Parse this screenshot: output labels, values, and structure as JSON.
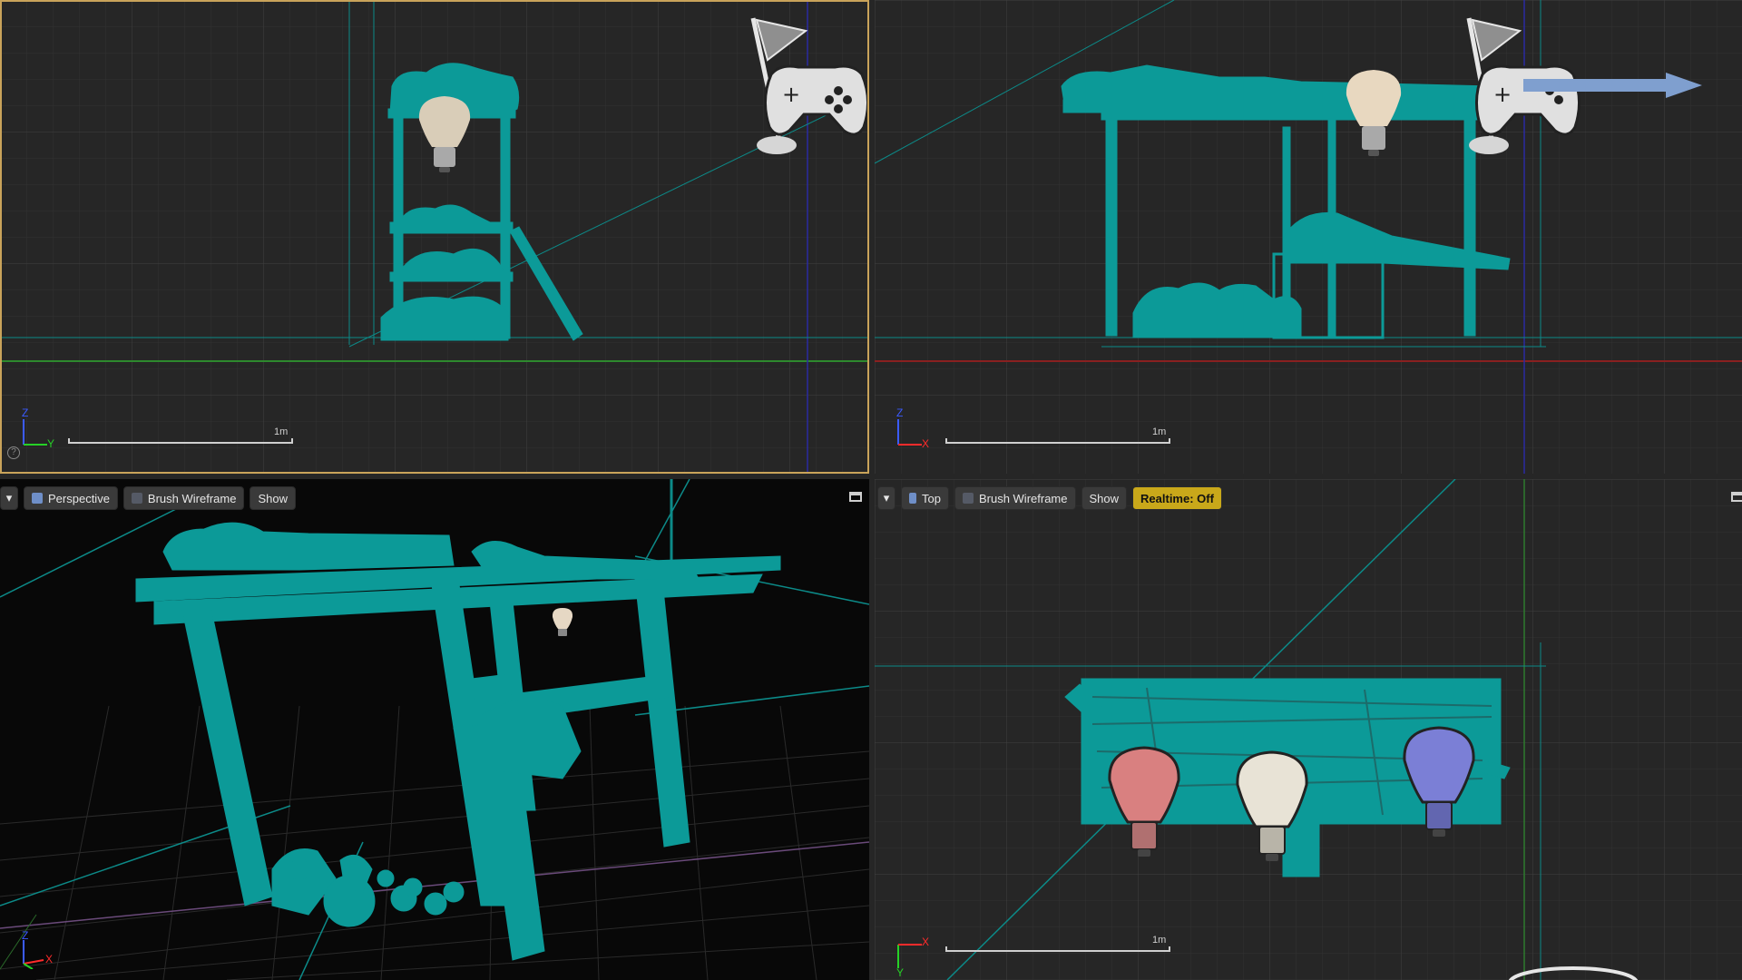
{
  "viewports": {
    "side": {
      "scale_label": "1m",
      "axis_up": "Z",
      "axis_right": "Y"
    },
    "front": {
      "scale_label": "1m",
      "axis_up": "Z",
      "axis_right": "X"
    },
    "perspective": {
      "toolbar": {
        "view_label": "Perspective",
        "mode_label": "Brush Wireframe",
        "show_label": "Show"
      },
      "axis_up": "Z",
      "axis_right": "X"
    },
    "top": {
      "toolbar": {
        "view_label": "Top",
        "mode_label": "Brush Wireframe",
        "show_label": "Show",
        "realtime_label": "Realtime: Off"
      },
      "scale_label": "1m",
      "axis_up": "Y",
      "axis_right": "X"
    }
  },
  "icons": [
    "dropdown-arrow-icon",
    "perspective-icon",
    "wireframe-icon",
    "maximize-icon",
    "flag-icon",
    "gamepad-icon",
    "lightbulb-icon",
    "arrow-gizmo-icon",
    "help-icon"
  ],
  "colors": {
    "mesh": "#0c9a98",
    "grid": "#333333",
    "active_border": "#c9a35a",
    "realtime_bg": "#c9a81a",
    "axis_x": "#ff2b2b",
    "axis_y": "#26d126",
    "axis_z": "#3b5bff",
    "bulb_red": "#d98080",
    "bulb_white": "#e8e3d6",
    "bulb_blue": "#7b7fd6"
  }
}
